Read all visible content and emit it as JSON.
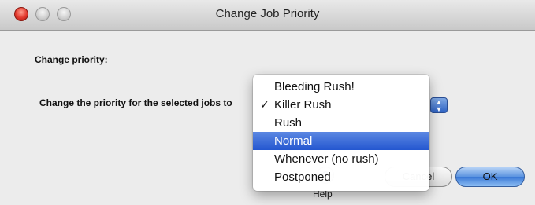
{
  "window": {
    "title": "Change Job Priority"
  },
  "section_label": "Change priority:",
  "prompt": "Change the priority for the selected jobs to",
  "menu": {
    "items": [
      {
        "label": "Bleeding Rush!",
        "checked": false,
        "highlighted": false
      },
      {
        "label": "Killer Rush",
        "checked": true,
        "highlighted": false
      },
      {
        "label": "Rush",
        "checked": false,
        "highlighted": false
      },
      {
        "label": "Normal",
        "checked": false,
        "highlighted": true
      },
      {
        "label": "Whenever (no rush)",
        "checked": false,
        "highlighted": false
      },
      {
        "label": "Postponed",
        "checked": false,
        "highlighted": false
      }
    ],
    "check_glyph": "✓"
  },
  "buttons": {
    "cancel": "Cancel",
    "ok": "OK",
    "help": "Help",
    "help_glyph": "?"
  },
  "stepper_glyph": "▲▼",
  "colors": {
    "accent": "#2457d0",
    "close": "#e2382c"
  }
}
